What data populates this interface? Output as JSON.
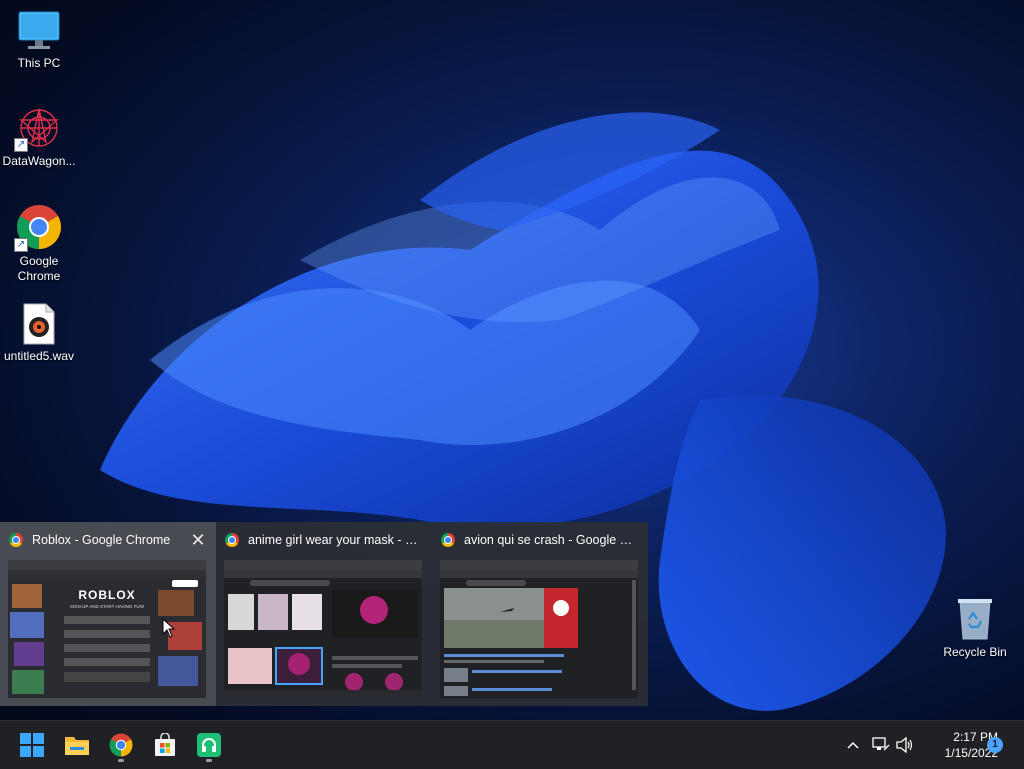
{
  "desktop": {
    "icons": [
      {
        "label": "This PC",
        "icon": "monitor-icon"
      },
      {
        "label": "DataWagon...",
        "icon": "datawagon-app-icon",
        "shortcut": true
      },
      {
        "label": "Google Chrome",
        "icon": "chrome-icon",
        "shortcut": true
      },
      {
        "label": "untitled5.wav",
        "icon": "audio-file-icon"
      },
      {
        "label": "Recycle Bin",
        "icon": "recycle-bin-icon"
      }
    ]
  },
  "taskbar_preview": {
    "windows": [
      {
        "title": "Roblox - Google Chrome",
        "close": "✕",
        "active": true,
        "preview_text": "ROBLOX",
        "preview_subtext": "SIGN UP AND START HAVING FUN!"
      },
      {
        "title": "anime girl wear your mask - G...",
        "active": false
      },
      {
        "title": "avion qui se crash - Google S...",
        "active": false
      }
    ]
  },
  "taskbar": {
    "pinned": [
      {
        "name": "start-button",
        "icon": "windows-logo-icon"
      },
      {
        "name": "file-explorer-button",
        "icon": "folder-icon"
      },
      {
        "name": "chrome-taskbar-button",
        "icon": "chrome-icon",
        "running": true
      },
      {
        "name": "microsoft-store-button",
        "icon": "store-icon"
      },
      {
        "name": "app-taskbar-button",
        "icon": "headphones-app-icon",
        "running": true
      }
    ],
    "tray": {
      "chevron": "^",
      "time": "2:17 PM",
      "date": "1/15/2022",
      "notifications": "1"
    }
  },
  "colors": {
    "accent": "#0078d4",
    "taskbar": "#202124",
    "preview_bg": "#2c2e34"
  }
}
